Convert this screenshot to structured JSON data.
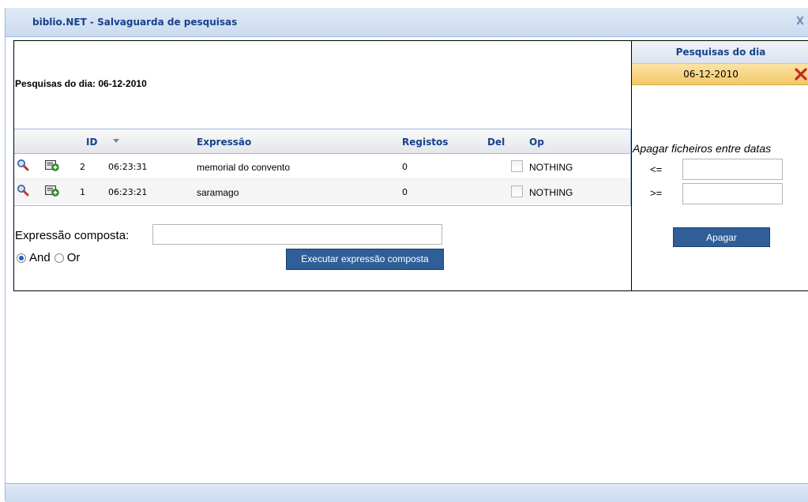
{
  "window": {
    "title": "biblio.NET - Salvaguarda de pesquisas",
    "close": "X"
  },
  "left": {
    "heading": "Pesquisas do dia: 06-12-2010",
    "grid": {
      "columns": [
        "ID",
        "Expressão",
        "Registos",
        "Del",
        "Op"
      ],
      "rows": [
        {
          "id": "2",
          "time": "06:23:31",
          "expression": "memorial do convento",
          "records": "0",
          "op": "NOTHING"
        },
        {
          "id": "1",
          "time": "06:23:21",
          "expression": "saramago",
          "records": "0",
          "op": "NOTHING"
        }
      ]
    },
    "composite": {
      "label": "Expressão composta:",
      "value": "",
      "and_label": "And",
      "or_label": "Or",
      "selected": "And",
      "button": "Executar expressão composta"
    }
  },
  "right": {
    "header": "Pesquisas do dia",
    "dates": [
      "06-12-2010"
    ],
    "delete_title": "Apagar ficheiros entre datas",
    "le_label": "<=",
    "ge_label": ">=",
    "button": "Apagar"
  },
  "colors": {
    "accent": "#15428b",
    "button": "#2f5e99",
    "selected_row": "#f3c867"
  }
}
